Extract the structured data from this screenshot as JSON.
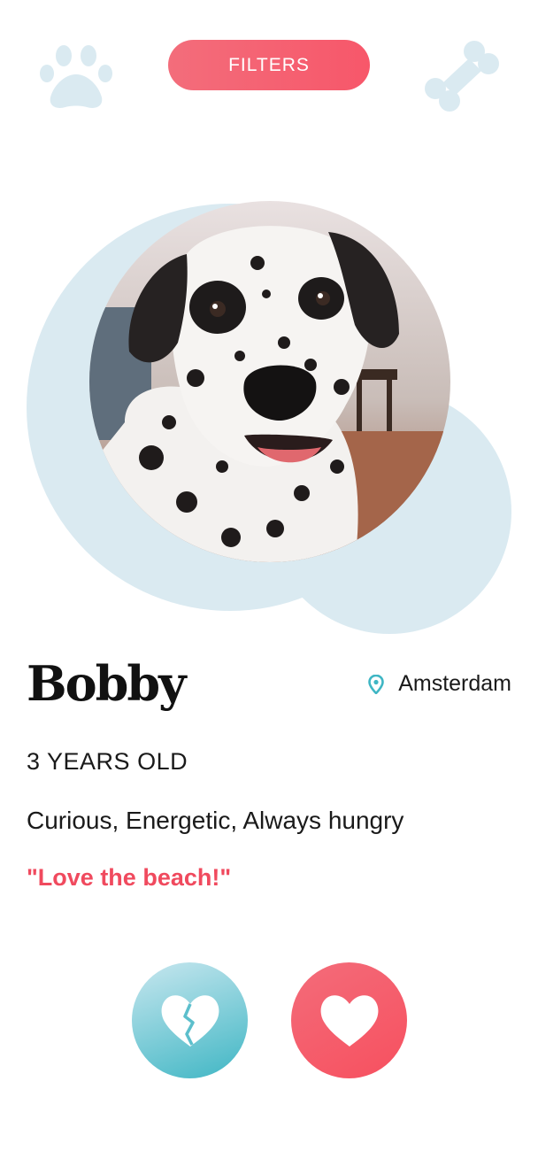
{
  "header": {
    "filters_label": "FILTERS",
    "left_icon": "paw-icon",
    "right_icon": "bone-icon"
  },
  "profile": {
    "name": "Bobby",
    "location": "Amsterdam",
    "age": "3 YEARS OLD",
    "traits": "Curious, Energetic, Always hungry",
    "quote": "\"Love the beach!\""
  },
  "actions": {
    "dislike_icon": "broken-heart-icon",
    "like_icon": "heart-icon"
  },
  "colors": {
    "accent": "#f7576a",
    "teal": "#3fb6c4",
    "light_blue": "#daeaf1"
  }
}
